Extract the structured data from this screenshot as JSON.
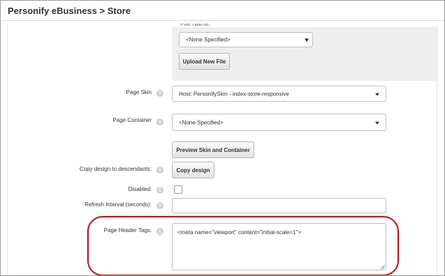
{
  "window": {
    "title": "Personify eBusiness > Store"
  },
  "file_panel": {
    "label_fragment": "File Name:",
    "file_select_value": "<None Specified>",
    "upload_button": "Upload New File"
  },
  "page_skin": {
    "label": "Page Skin",
    "value": "Host: PersonifySkin - index-store-responsive"
  },
  "page_container": {
    "label": "Page Container",
    "value": "<None Specified>"
  },
  "preview_button": "Preview Skin and Container",
  "copy_design": {
    "label": "Copy design to descendants:",
    "button": "Copy design"
  },
  "disabled": {
    "label": "Disabled:",
    "checked": false
  },
  "refresh_interval": {
    "label": "Refresh Interval (seconds):",
    "value": ""
  },
  "page_header_tags": {
    "label": "Page Header Tags:",
    "value": "<meta name=\"viewport\" content=\"initial-scale=1\">"
  },
  "icons": {
    "info": "info-icon",
    "dropdown": "chevron-down-icon"
  },
  "colors": {
    "highlight": "#b5161b",
    "panel_bg": "#eeeeee"
  }
}
